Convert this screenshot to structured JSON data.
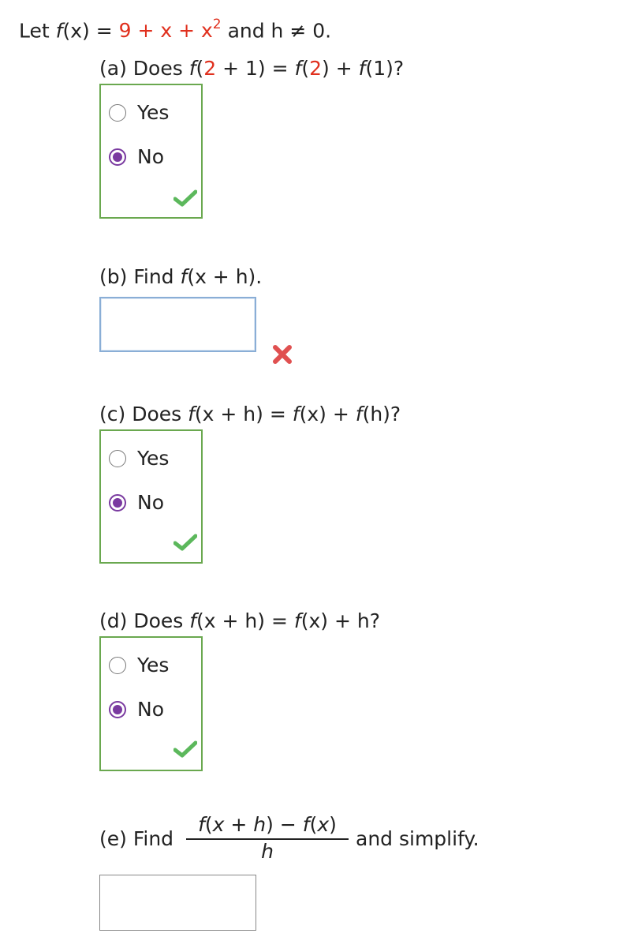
{
  "problem": {
    "let": "Let",
    "fname": "f",
    "arg": "(x)",
    "eq": "=",
    "expr": "9 + x + x",
    "exp": "2",
    "cond": "and h ≠ 0."
  },
  "parts": {
    "a": {
      "prefix": "(a) Does",
      "left_f": "f",
      "left_arg1": "(",
      "left_red": "2",
      "left_arg2": " + 1)",
      "eq": "=",
      "rhs_f": "f",
      "rhs_open": "(",
      "rhs_red": "2",
      "rhs_rest": ") + ",
      "rhs_f2": "f",
      "rhs_end": "(1)?",
      "yes": "Yes",
      "no": "No",
      "selected": "No",
      "status": "correct"
    },
    "b": {
      "prefix": "(b) Find",
      "fn": "f",
      "arg": "(x + h).",
      "answer": "",
      "status": "incorrect"
    },
    "c": {
      "prefix": "(c) Does",
      "lhs_f": "f",
      "lhs_arg": "(x + h)",
      "eq": "=",
      "rhs_f": "f",
      "rhs_arg": "(x) + ",
      "rhs_f2": "f",
      "rhs_arg2": "(h)?",
      "yes": "Yes",
      "no": "No",
      "selected": "No",
      "status": "correct"
    },
    "d": {
      "prefix": "(d) Does",
      "lhs_f": "f",
      "lhs_arg": "(x + h)",
      "eq": "=",
      "rhs_f": "f",
      "rhs_arg": "(x) + h?",
      "yes": "Yes",
      "no": "No",
      "selected": "No",
      "status": "correct"
    },
    "e": {
      "prefix": "(e) Find",
      "numerator": "f(x + h) − f(x)",
      "denominator": "h",
      "suffix": "and simplify.",
      "answer": ""
    }
  },
  "colors": {
    "red": "#e0301e",
    "green_border": "#6aa84f",
    "check_green": "#5cb85c",
    "radio_purple": "#7a3aa0",
    "x_red": "#e05050"
  }
}
